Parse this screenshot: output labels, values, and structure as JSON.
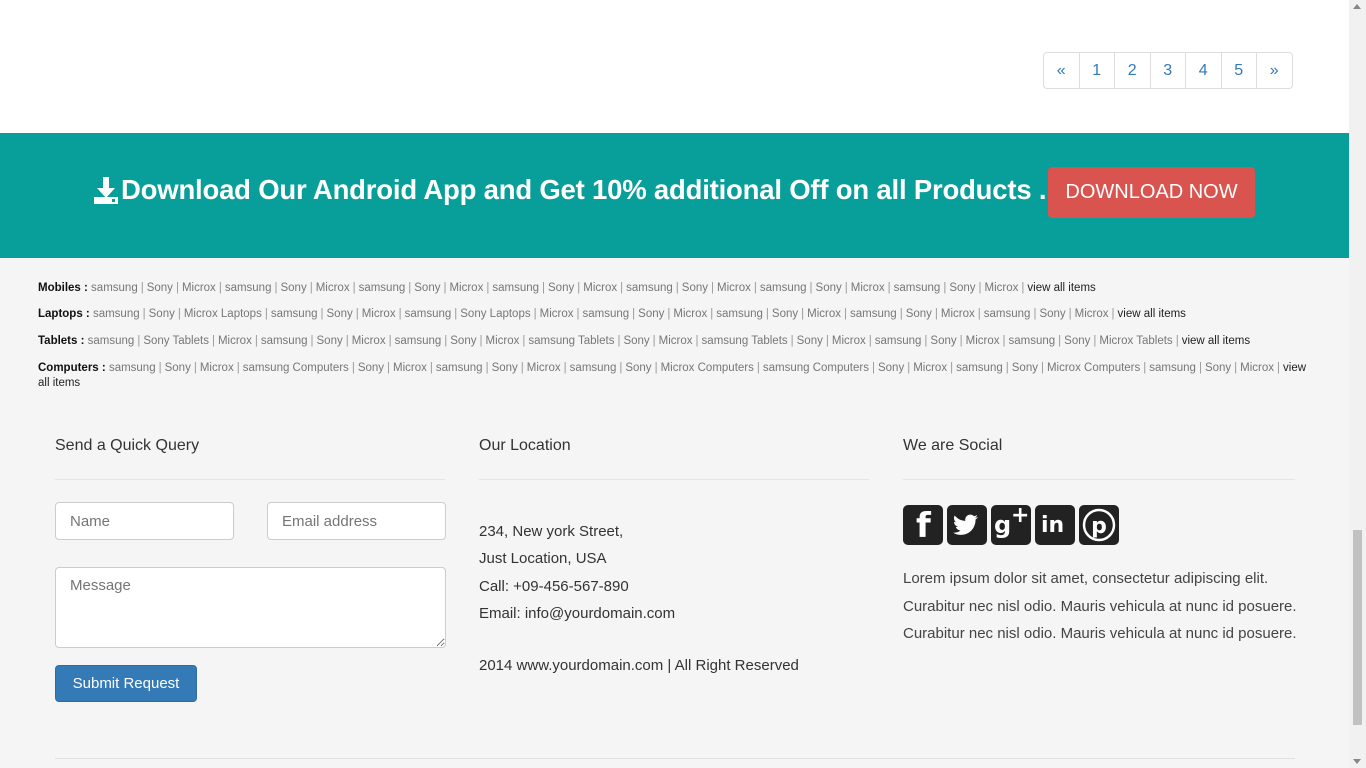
{
  "pagination": {
    "prev": "«",
    "pages": [
      "1",
      "2",
      "3",
      "4",
      "5"
    ],
    "next": "»"
  },
  "banner": {
    "icon": "download-icon",
    "text": "Download Our Android App and Get 10% additional Off on all Products .",
    "button_label": "DOWNLOAD NOW",
    "bg_color": "#089e99",
    "button_color": "#d9534f"
  },
  "categories": [
    {
      "label": "Mobiles :",
      "items": [
        "samsung",
        "Sony",
        "Microx",
        "samsung",
        "Sony",
        "Microx",
        "samsung",
        "Sony",
        "Microx",
        "samsung",
        "Sony",
        "Microx",
        "samsung",
        "Sony",
        "Microx",
        "samsung",
        "Sony",
        "Microx",
        "samsung",
        "Sony",
        "Microx"
      ],
      "view_all": "view all items"
    },
    {
      "label": "Laptops :",
      "items": [
        "samsung",
        "Sony",
        "Microx Laptops",
        "samsung",
        "Sony",
        "Microx",
        "samsung",
        "Sony Laptops",
        "Microx",
        "samsung",
        "Sony",
        "Microx",
        "samsung",
        "Sony",
        "Microx",
        "samsung",
        "Sony",
        "Microx",
        "samsung",
        "Sony",
        "Microx"
      ],
      "view_all": "view all items"
    },
    {
      "label": "Tablets :",
      "items": [
        "samsung",
        "Sony Tablets",
        "Microx",
        "samsung",
        "Sony",
        "Microx",
        "samsung",
        "Sony",
        "Microx",
        "samsung Tablets",
        "Sony",
        "Microx",
        "samsung Tablets",
        "Sony",
        "Microx",
        "samsung",
        "Sony",
        "Microx",
        "samsung",
        "Sony",
        "Microx Tablets"
      ],
      "view_all": "view all items"
    },
    {
      "label": "Computers :",
      "items": [
        "samsung",
        "Sony",
        "Microx",
        "samsung Computers",
        "Sony",
        "Microx",
        "samsung",
        "Sony",
        "Microx",
        "samsung",
        "Sony",
        "Microx Computers",
        "samsung Computers",
        "Sony",
        "Microx",
        "samsung",
        "Sony",
        "Microx Computers",
        "samsung",
        "Sony",
        "Microx"
      ],
      "view_all": "view all items"
    }
  ],
  "query": {
    "title": "Send a Quick Query",
    "name_placeholder": "Name",
    "email_placeholder": "Email address",
    "message_placeholder": "Message",
    "submit_label": "Submit Request"
  },
  "location": {
    "title": "Our Location",
    "address1": "234, New york Street,",
    "address2": "Just Location, USA",
    "phone": "Call: +09-456-567-890",
    "email": "Email: info@yourdomain.com",
    "copyright": "2014 www.yourdomain.com | All Right Reserved"
  },
  "social": {
    "title": "We are Social",
    "icons": [
      "facebook-icon",
      "twitter-icon",
      "google-plus-icon",
      "linkedin-icon",
      "pinterest-icon"
    ],
    "text": "Lorem ipsum dolor sit amet, consectetur adipiscing elit. Curabitur nec nisl odio. Mauris vehicula at nunc id posuere. Curabitur nec nisl odio. Mauris vehicula at nunc id posuere."
  }
}
